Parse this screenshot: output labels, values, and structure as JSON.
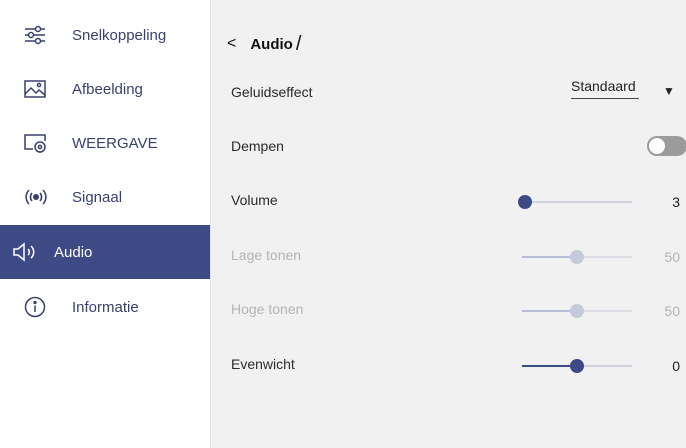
{
  "sidebar": {
    "items": [
      {
        "label": "Snelkoppeling",
        "icon": "sliders-icon"
      },
      {
        "label": "Afbeelding",
        "icon": "picture-icon"
      },
      {
        "label": "WEERGAVE",
        "icon": "display-settings-icon"
      },
      {
        "label": "Signaal",
        "icon": "signal-icon"
      },
      {
        "label": "Audio",
        "icon": "speaker-icon",
        "active": true
      },
      {
        "label": "Informatie",
        "icon": "info-icon"
      }
    ]
  },
  "header": {
    "back": "<",
    "title": "Audio",
    "slash": "/"
  },
  "settings": {
    "sound_effect": {
      "label": "Geluidseffect",
      "value": "Standaard"
    },
    "mute": {
      "label": "Dempen",
      "on": false
    },
    "volume": {
      "label": "Volume",
      "value": "3",
      "level": 3,
      "max": 100
    },
    "bass": {
      "label": "Lage tonen",
      "value": "50",
      "level": 50,
      "max": 100,
      "disabled": true
    },
    "treble": {
      "label": "Hoge tonen",
      "value": "50",
      "level": 50,
      "max": 100,
      "disabled": true
    },
    "balance": {
      "label": "Evenwicht",
      "value": "0",
      "level": 0,
      "min": -50,
      "max": 50
    }
  },
  "colors": {
    "accent": "#3d4a86",
    "sidebar_text": "#3a3f6e",
    "panel_bg": "#f1f1f1"
  }
}
